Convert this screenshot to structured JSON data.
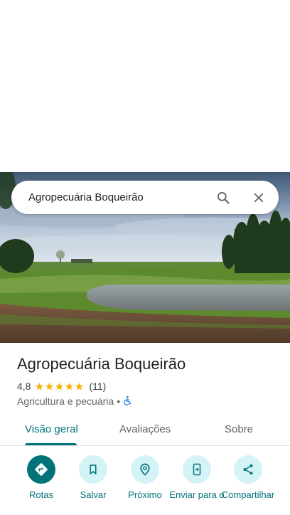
{
  "search": {
    "query": "Agropecuária Boqueirão"
  },
  "place": {
    "name": "Agropecuária Boqueirão",
    "rating": "4,8",
    "rating_stars": 5,
    "review_count": "(11)",
    "category": "Agricultura e pecuária",
    "separator": "•"
  },
  "tabs": [
    {
      "label": "Visão geral",
      "active": true
    },
    {
      "label": "Avaliações",
      "active": false
    },
    {
      "label": "Sobre",
      "active": false
    }
  ],
  "actions": [
    {
      "label": "Rotas",
      "icon": "directions-icon"
    },
    {
      "label": "Salvar",
      "icon": "bookmark-icon"
    },
    {
      "label": "Próximo",
      "icon": "nearby-icon"
    },
    {
      "label": "Enviar para o",
      "icon": "send-to-phone-icon"
    },
    {
      "label": "Compartilhar",
      "icon": "share-icon"
    }
  ],
  "colors": {
    "accent": "#00737a",
    "accent_light": "#d3f3f6",
    "star": "#f6b400",
    "accessibility": "#1a73e8"
  }
}
